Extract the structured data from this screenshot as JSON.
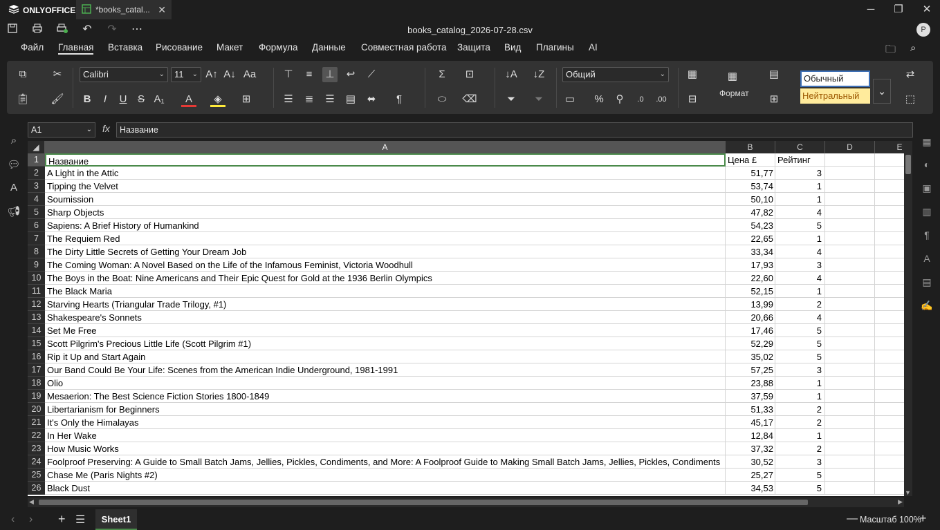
{
  "app": {
    "name": "ONLYOFFICE"
  },
  "tab": {
    "title": "*books_catal..."
  },
  "document": {
    "title": "books_catalog_2026-07-28.csv"
  },
  "user": {
    "avatar_letter": "P"
  },
  "menu": [
    "Файл",
    "Главная",
    "Вставка",
    "Рисование",
    "Макет",
    "Формула",
    "Данные",
    "Совместная работа",
    "Защита",
    "Вид",
    "Плагины",
    "AI"
  ],
  "ribbon": {
    "font_name": "Calibri",
    "font_size": "11",
    "number_format": "Общий",
    "format_label": "Формат",
    "style_normal": "Обычный",
    "style_neutral": "Нейтральный"
  },
  "formula_bar": {
    "cell_ref": "A1",
    "fx": "fx",
    "value": "Название"
  },
  "columns": [
    "A",
    "B",
    "C",
    "D",
    "E"
  ],
  "header_row": {
    "num": "1",
    "a": "Название",
    "b": "Цена £",
    "c": "Рейтинг"
  },
  "rows": [
    {
      "num": "2",
      "title": "A Light in the Attic",
      "price": "51,77",
      "rating": "3"
    },
    {
      "num": "3",
      "title": "Tipping the Velvet",
      "price": "53,74",
      "rating": "1"
    },
    {
      "num": "4",
      "title": "Soumission",
      "price": "50,10",
      "rating": "1"
    },
    {
      "num": "5",
      "title": "Sharp Objects",
      "price": "47,82",
      "rating": "4"
    },
    {
      "num": "6",
      "title": "Sapiens: A Brief History of Humankind",
      "price": "54,23",
      "rating": "5"
    },
    {
      "num": "7",
      "title": "The Requiem Red",
      "price": "22,65",
      "rating": "1"
    },
    {
      "num": "8",
      "title": "The Dirty Little Secrets of Getting Your Dream Job",
      "price": "33,34",
      "rating": "4"
    },
    {
      "num": "9",
      "title": "The Coming Woman: A Novel Based on the Life of the Infamous Feminist, Victoria Woodhull",
      "price": "17,93",
      "rating": "3"
    },
    {
      "num": "10",
      "title": "The Boys in the Boat: Nine Americans and Their Epic Quest for Gold at the 1936 Berlin Olympics",
      "price": "22,60",
      "rating": "4"
    },
    {
      "num": "11",
      "title": "The Black Maria",
      "price": "52,15",
      "rating": "1"
    },
    {
      "num": "12",
      "title": "Starving Hearts (Triangular Trade Trilogy, #1)",
      "price": "13,99",
      "rating": "2"
    },
    {
      "num": "13",
      "title": "Shakespeare's Sonnets",
      "price": "20,66",
      "rating": "4"
    },
    {
      "num": "14",
      "title": "Set Me Free",
      "price": "17,46",
      "rating": "5"
    },
    {
      "num": "15",
      "title": "Scott Pilgrim's Precious Little Life (Scott Pilgrim #1)",
      "price": "52,29",
      "rating": "5"
    },
    {
      "num": "16",
      "title": "Rip it Up and Start Again",
      "price": "35,02",
      "rating": "5"
    },
    {
      "num": "17",
      "title": "Our Band Could Be Your Life: Scenes from the American Indie Underground, 1981-1991",
      "price": "57,25",
      "rating": "3"
    },
    {
      "num": "18",
      "title": "Olio",
      "price": "23,88",
      "rating": "1"
    },
    {
      "num": "19",
      "title": "Mesaerion: The Best Science Fiction Stories 1800-1849",
      "price": "37,59",
      "rating": "1"
    },
    {
      "num": "20",
      "title": "Libertarianism for Beginners",
      "price": "51,33",
      "rating": "2"
    },
    {
      "num": "21",
      "title": "It's Only the Himalayas",
      "price": "45,17",
      "rating": "2"
    },
    {
      "num": "22",
      "title": "In Her Wake",
      "price": "12,84",
      "rating": "1"
    },
    {
      "num": "23",
      "title": "How Music Works",
      "price": "37,32",
      "rating": "2"
    },
    {
      "num": "24",
      "title": "Foolproof Preserving: A Guide to Small Batch Jams, Jellies, Pickles, Condiments, and More: A Foolproof Guide to Making Small Batch Jams, Jellies, Pickles, Condiments",
      "price": "30,52",
      "rating": "3"
    },
    {
      "num": "25",
      "title": "Chase Me (Paris Nights #2)",
      "price": "25,27",
      "rating": "5"
    },
    {
      "num": "26",
      "title": "Black Dust",
      "price": "34,53",
      "rating": "5"
    }
  ],
  "status": {
    "sheet": "Sheet1",
    "zoom": "Масштаб 100%"
  },
  "colors": {
    "accent": "#4a8a4a",
    "neutral_bg": "#ffeb9c",
    "neutral_fg": "#9c5700"
  }
}
